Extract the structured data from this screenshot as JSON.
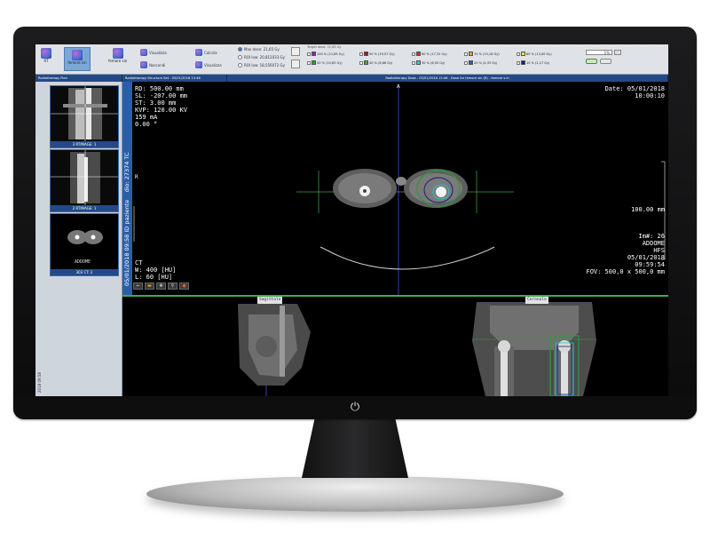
{
  "ribbon": {
    "btn_1": "RT",
    "btn_2": "femore sin",
    "btn_3": "femore sin",
    "btn_visualizza": "Visualizza",
    "btn_nascondi": "Nascondi",
    "btn_calcola": "Calcola",
    "btn_visualizza2": "Visualizza",
    "radio_max": "Max dose: 21,65 Gy",
    "radio_roi_low": "ROI low: 20,812033 Gy",
    "radio_roi_high": "ROI low: 18,556072 Gy",
    "legend_title": "Target dose: 21,65 Gy",
    "zoom_value": "1%",
    "legend": [
      {
        "label": "100 % (21,65 Gy)",
        "color": "#9b1bb3"
      },
      {
        "label": "90 % (19,57 Gy)",
        "color": "#a0192a"
      },
      {
        "label": "80 % (17,32 Gy)",
        "color": "#e8222a"
      },
      {
        "label": "70 % (15,16 Gy)",
        "color": "#f49e1c"
      },
      {
        "label": "60 % (13,00 Gy)",
        "color": "#f2e52a"
      },
      {
        "label": "50 % (10,83 Gy)",
        "color": "#2a9b3a"
      },
      {
        "label": "40 % (8,66 Gy)",
        "color": "#4ea62d"
      },
      {
        "label": "30 % (6,50 Gy)",
        "color": "#1fd1cf"
      },
      {
        "label": "20 % (4,33 Gy)",
        "color": "#2b59c3"
      },
      {
        "label": "10 % (2,17 Gy)",
        "color": "#1b1f7a"
      }
    ]
  },
  "tabs": [
    "Radiotherapy Plan",
    "Radiotherapy Structure Set - 05/01/2018 15:46",
    "Radiotherapy Dose - 05/01/2018 15:46 - Dose for femore sin (R) - femore s.in"
  ],
  "thumbnails": [
    {
      "caption": "3 RTIMAGE: 1"
    },
    {
      "caption": "2 RTIMAGE: 1"
    },
    {
      "caption": "303 CT: 2",
      "label": "ADDOME"
    }
  ],
  "side_date": "2018 09:58",
  "viewer": {
    "vbar_text": "05/01/2018 09:58 ID paziente",
    "vbar_text_top": "dio: 27374 TC",
    "orient_top": "A",
    "orient_left": "R",
    "info_left": [
      "RD: 500.00 mm",
      "SL: -207.00 mm",
      "ST: 3.00 mm",
      "KVP: 120.00 KV",
      "159 mA",
      "0.00 °"
    ],
    "info_left_bottom": [
      "CT",
      "W: 400 [HU]",
      "L: 60 [HU]"
    ],
    "date_top": "Date: 05/01/2018",
    "time_top": "10:00:10",
    "scale": "100.00 mm",
    "info_right_bottom": [
      "Im#: 26",
      "ADDOME",
      "HFS",
      "05/01/2018",
      "09:59:54",
      "FOV: 500,0 x 500,0 mm"
    ],
    "sag_label": "Sagittale",
    "cor_label": "Coronale"
  }
}
